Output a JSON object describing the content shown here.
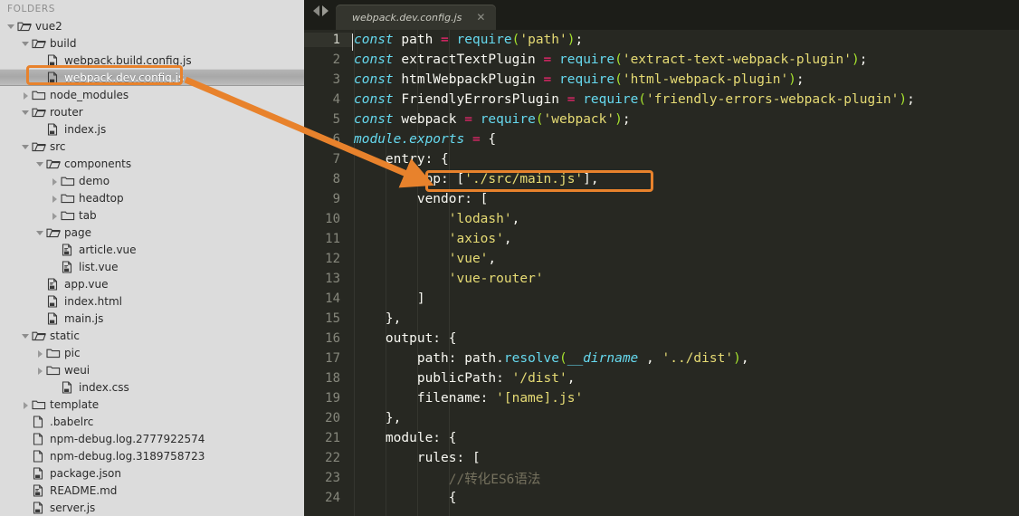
{
  "sidebar": {
    "title": "FOLDERS",
    "selected_file": "webpack.dev.config.js",
    "items": [
      {
        "label": "vue2",
        "type": "folder-open",
        "depth": 0,
        "twisty": "open"
      },
      {
        "label": "build",
        "type": "folder-open",
        "depth": 1,
        "twisty": "open"
      },
      {
        "label": "webpack.build.config.js",
        "type": "file-js",
        "depth": 2,
        "twisty": "none"
      },
      {
        "label": "webpack.dev.config.js",
        "type": "file-js",
        "depth": 2,
        "twisty": "none",
        "selected": true
      },
      {
        "label": "node_modules",
        "type": "folder-closed",
        "depth": 1,
        "twisty": "closed"
      },
      {
        "label": "router",
        "type": "folder-open",
        "depth": 1,
        "twisty": "open"
      },
      {
        "label": "index.js",
        "type": "file-js",
        "depth": 2,
        "twisty": "none"
      },
      {
        "label": "src",
        "type": "folder-open",
        "depth": 1,
        "twisty": "open"
      },
      {
        "label": "components",
        "type": "folder-open",
        "depth": 2,
        "twisty": "open"
      },
      {
        "label": "demo",
        "type": "folder-closed",
        "depth": 3,
        "twisty": "closed"
      },
      {
        "label": "headtop",
        "type": "folder-closed",
        "depth": 3,
        "twisty": "closed"
      },
      {
        "label": "tab",
        "type": "folder-closed",
        "depth": 3,
        "twisty": "closed"
      },
      {
        "label": "page",
        "type": "folder-open",
        "depth": 2,
        "twisty": "open"
      },
      {
        "label": "article.vue",
        "type": "file-vue",
        "depth": 3,
        "twisty": "none"
      },
      {
        "label": "list.vue",
        "type": "file-vue",
        "depth": 3,
        "twisty": "none"
      },
      {
        "label": "app.vue",
        "type": "file-vue",
        "depth": 2,
        "twisty": "none"
      },
      {
        "label": "index.html",
        "type": "file-html",
        "depth": 2,
        "twisty": "none"
      },
      {
        "label": "main.js",
        "type": "file-js",
        "depth": 2,
        "twisty": "none"
      },
      {
        "label": "static",
        "type": "folder-open",
        "depth": 1,
        "twisty": "open"
      },
      {
        "label": "pic",
        "type": "folder-closed",
        "depth": 2,
        "twisty": "closed"
      },
      {
        "label": "weui",
        "type": "folder-closed",
        "depth": 2,
        "twisty": "closed"
      },
      {
        "label": "index.css",
        "type": "file-css",
        "depth": 3,
        "twisty": "none"
      },
      {
        "label": "template",
        "type": "folder-closed",
        "depth": 1,
        "twisty": "closed"
      },
      {
        "label": ".babelrc",
        "type": "file-plain",
        "depth": 1,
        "twisty": "none"
      },
      {
        "label": "npm-debug.log.2777922574",
        "type": "file-plain",
        "depth": 1,
        "twisty": "none"
      },
      {
        "label": "npm-debug.log.3189758723",
        "type": "file-plain",
        "depth": 1,
        "twisty": "none"
      },
      {
        "label": "package.json",
        "type": "file-json",
        "depth": 1,
        "twisty": "none"
      },
      {
        "label": "README.md",
        "type": "file-md",
        "depth": 1,
        "twisty": "none"
      },
      {
        "label": "server.js",
        "type": "file-js",
        "depth": 1,
        "twisty": "none"
      }
    ]
  },
  "editor": {
    "tab": {
      "label": "webpack.dev.config.js",
      "close_glyph": "✕"
    },
    "nav_prev": "prev-file",
    "nav_next": "next-file",
    "active_line": 1,
    "lines": [
      {
        "n": "1",
        "tokens": [
          {
            "c": "t-kw",
            "t": "const"
          },
          {
            "c": "t-pl",
            "t": " path "
          },
          {
            "c": "t-op",
            "t": "="
          },
          {
            "c": "t-pl",
            "t": " "
          },
          {
            "c": "t-fn2",
            "t": "require"
          },
          {
            "c": "t-fn",
            "t": "("
          },
          {
            "c": "t-str",
            "t": "'path'"
          },
          {
            "c": "t-fn",
            "t": ")"
          },
          {
            "c": "t-pl",
            "t": ";"
          }
        ]
      },
      {
        "n": "2",
        "tokens": [
          {
            "c": "t-kw",
            "t": "const"
          },
          {
            "c": "t-pl",
            "t": " extractTextPlugin "
          },
          {
            "c": "t-op",
            "t": "="
          },
          {
            "c": "t-pl",
            "t": " "
          },
          {
            "c": "t-fn2",
            "t": "require"
          },
          {
            "c": "t-fn",
            "t": "("
          },
          {
            "c": "t-str",
            "t": "'extract-text-webpack-plugin'"
          },
          {
            "c": "t-fn",
            "t": ")"
          },
          {
            "c": "t-pl",
            "t": ";"
          }
        ]
      },
      {
        "n": "3",
        "tokens": [
          {
            "c": "t-kw",
            "t": "const"
          },
          {
            "c": "t-pl",
            "t": " htmlWebpackPlugin "
          },
          {
            "c": "t-op",
            "t": "="
          },
          {
            "c": "t-pl",
            "t": " "
          },
          {
            "c": "t-fn2",
            "t": "require"
          },
          {
            "c": "t-fn",
            "t": "("
          },
          {
            "c": "t-str",
            "t": "'html-webpack-plugin'"
          },
          {
            "c": "t-fn",
            "t": ")"
          },
          {
            "c": "t-pl",
            "t": ";"
          }
        ]
      },
      {
        "n": "4",
        "tokens": [
          {
            "c": "t-kw",
            "t": "const"
          },
          {
            "c": "t-pl",
            "t": " FriendlyErrorsPlugin "
          },
          {
            "c": "t-op",
            "t": "="
          },
          {
            "c": "t-pl",
            "t": " "
          },
          {
            "c": "t-fn2",
            "t": "require"
          },
          {
            "c": "t-fn",
            "t": "("
          },
          {
            "c": "t-str",
            "t": "'friendly-errors-webpack-plugin'"
          },
          {
            "c": "t-fn",
            "t": ")"
          },
          {
            "c": "t-pl",
            "t": ";"
          }
        ]
      },
      {
        "n": "5",
        "tokens": [
          {
            "c": "t-kw",
            "t": "const"
          },
          {
            "c": "t-pl",
            "t": " webpack "
          },
          {
            "c": "t-op",
            "t": "="
          },
          {
            "c": "t-pl",
            "t": " "
          },
          {
            "c": "t-fn2",
            "t": "require"
          },
          {
            "c": "t-fn",
            "t": "("
          },
          {
            "c": "t-str",
            "t": "'webpack'"
          },
          {
            "c": "t-fn",
            "t": ")"
          },
          {
            "c": "t-pl",
            "t": ";"
          }
        ]
      },
      {
        "n": "6",
        "tokens": [
          {
            "c": "t-cn",
            "t": "module.exports"
          },
          {
            "c": "t-pl",
            "t": " "
          },
          {
            "c": "t-op",
            "t": "="
          },
          {
            "c": "t-pl",
            "t": " {"
          }
        ]
      },
      {
        "n": "7",
        "tokens": [
          {
            "c": "t-pl",
            "t": "    entry: {"
          }
        ]
      },
      {
        "n": "8",
        "tokens": [
          {
            "c": "t-pl",
            "t": "        app: ["
          },
          {
            "c": "t-str",
            "t": "'./src/main.js'"
          },
          {
            "c": "t-pl",
            "t": "],"
          }
        ]
      },
      {
        "n": "9",
        "tokens": [
          {
            "c": "t-pl",
            "t": "        vendor: ["
          }
        ]
      },
      {
        "n": "10",
        "tokens": [
          {
            "c": "t-pl",
            "t": "            "
          },
          {
            "c": "t-str",
            "t": "'lodash'"
          },
          {
            "c": "t-pl",
            "t": ","
          }
        ]
      },
      {
        "n": "11",
        "tokens": [
          {
            "c": "t-pl",
            "t": "            "
          },
          {
            "c": "t-str",
            "t": "'axios'"
          },
          {
            "c": "t-pl",
            "t": ","
          }
        ]
      },
      {
        "n": "12",
        "tokens": [
          {
            "c": "t-pl",
            "t": "            "
          },
          {
            "c": "t-str",
            "t": "'vue'"
          },
          {
            "c": "t-pl",
            "t": ","
          }
        ]
      },
      {
        "n": "13",
        "tokens": [
          {
            "c": "t-pl",
            "t": "            "
          },
          {
            "c": "t-str",
            "t": "'vue-router'"
          }
        ]
      },
      {
        "n": "14",
        "tokens": [
          {
            "c": "t-pl",
            "t": "        ]"
          }
        ]
      },
      {
        "n": "15",
        "tokens": [
          {
            "c": "t-pl",
            "t": "    },"
          }
        ]
      },
      {
        "n": "16",
        "tokens": [
          {
            "c": "t-pl",
            "t": "    output: {"
          }
        ]
      },
      {
        "n": "17",
        "tokens": [
          {
            "c": "t-pl",
            "t": "        path: path."
          },
          {
            "c": "t-fn2",
            "t": "resolve"
          },
          {
            "c": "t-fn",
            "t": "("
          },
          {
            "c": "t-cn",
            "t": "__dirname"
          },
          {
            "c": "t-pl",
            "t": " , "
          },
          {
            "c": "t-str",
            "t": "'../dist'"
          },
          {
            "c": "t-fn",
            "t": ")"
          },
          {
            "c": "t-pl",
            "t": ","
          }
        ]
      },
      {
        "n": "18",
        "tokens": [
          {
            "c": "t-pl",
            "t": "        publicPath: "
          },
          {
            "c": "t-str",
            "t": "'/dist'"
          },
          {
            "c": "t-pl",
            "t": ","
          }
        ]
      },
      {
        "n": "19",
        "tokens": [
          {
            "c": "t-pl",
            "t": "        filename: "
          },
          {
            "c": "t-str",
            "t": "'[name].js'"
          }
        ]
      },
      {
        "n": "20",
        "tokens": [
          {
            "c": "t-pl",
            "t": "    },"
          }
        ]
      },
      {
        "n": "21",
        "tokens": [
          {
            "c": "t-pl",
            "t": "    module: {"
          }
        ]
      },
      {
        "n": "22",
        "tokens": [
          {
            "c": "t-pl",
            "t": "        rules: ["
          }
        ]
      },
      {
        "n": "23",
        "tokens": [
          {
            "c": "t-pl",
            "t": "            "
          },
          {
            "c": "t-cm",
            "t": "//转化ES6语法"
          }
        ]
      },
      {
        "n": "24",
        "tokens": [
          {
            "c": "t-pl",
            "t": "            {"
          }
        ]
      }
    ]
  },
  "annotations": {
    "accent_color": "#e8822c",
    "highlight_sidebar_target": "webpack.dev.config.js",
    "highlight_code_target": "app: ['./src/main.js'],",
    "arrow": "sidebar-file-to-entry-app"
  },
  "theme": {
    "sidebar_bg": "#dcdcdc",
    "editor_bg": "#272822",
    "tabbar_bg": "#1c1d18",
    "keyword": "#66d9ef",
    "string": "#e6db74",
    "operator": "#f92672",
    "comment": "#75715e",
    "plain": "#f8f8f2",
    "gutter": "#86877c"
  }
}
